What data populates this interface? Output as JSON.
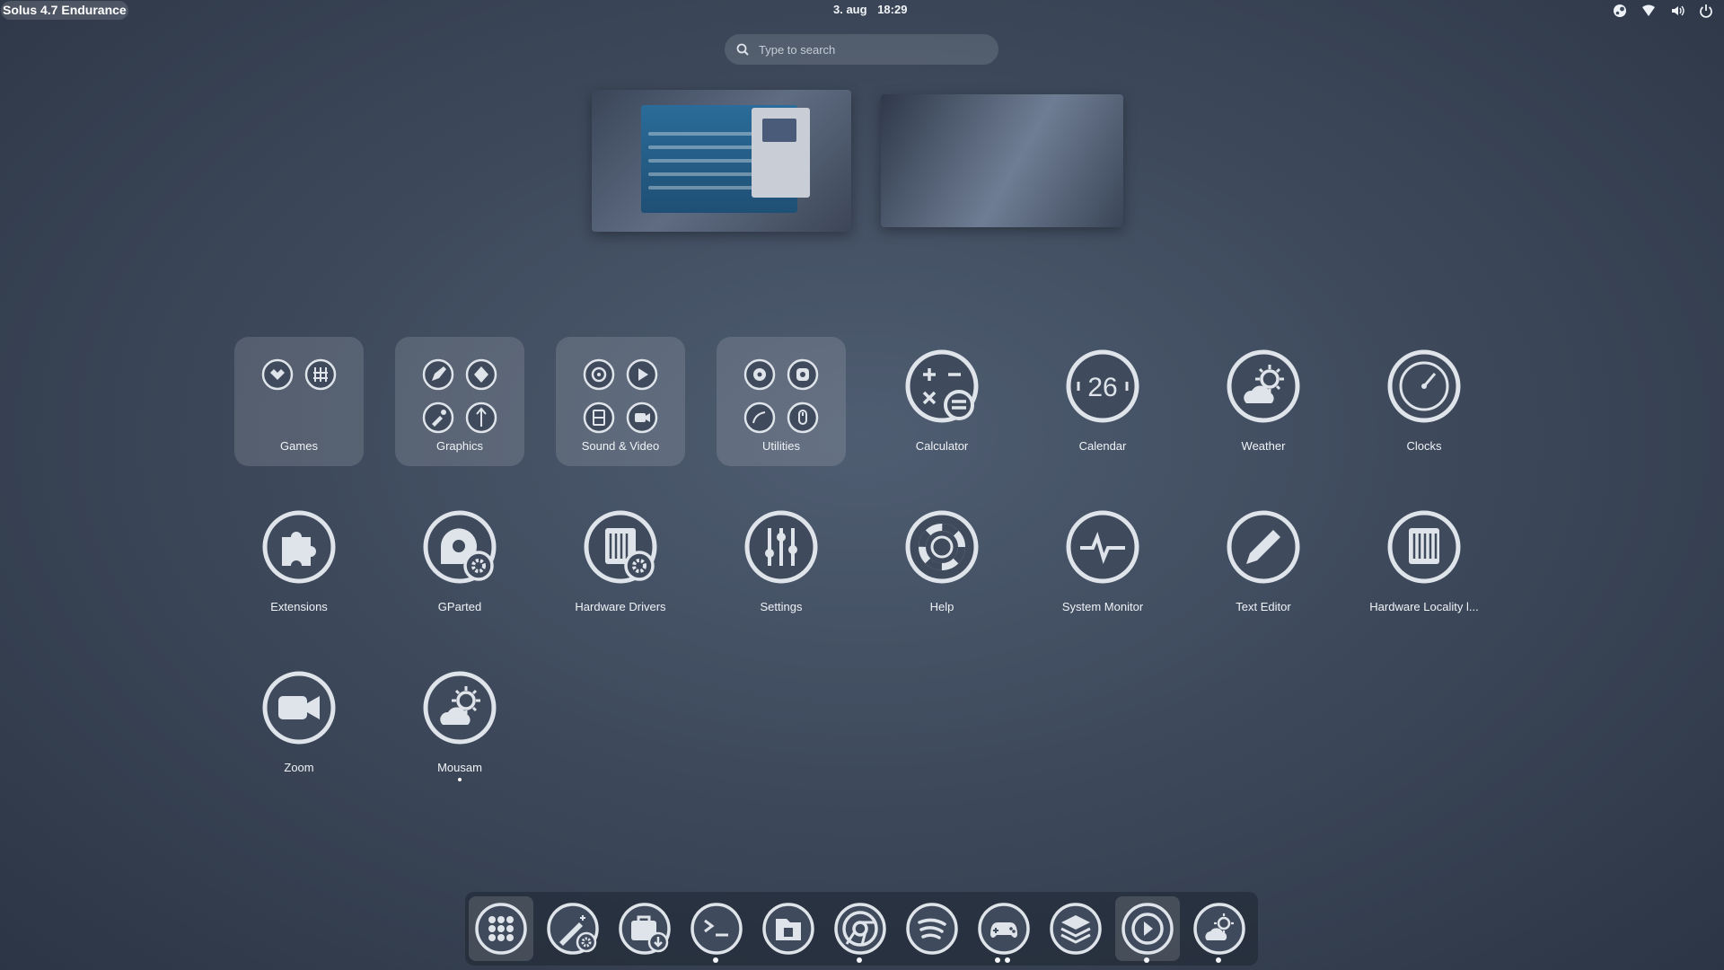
{
  "topbar": {
    "activities": "Solus 4.7 Endurance",
    "date": "3. aug",
    "time": "18:29",
    "tray_icons": [
      "steam-icon",
      "wifi-icon",
      "volume-icon",
      "power-icon"
    ]
  },
  "search": {
    "placeholder": "Type to search"
  },
  "workspaces": [
    "workspace-1",
    "workspace-2"
  ],
  "grid": {
    "row1": [
      {
        "label": "Games",
        "folder": true
      },
      {
        "label": "Graphics",
        "folder": true
      },
      {
        "label": "Sound & Video",
        "folder": true
      },
      {
        "label": "Utilities",
        "folder": true
      },
      {
        "label": "Calculator"
      },
      {
        "label": "Calendar",
        "icon_text": "26"
      },
      {
        "label": "Weather"
      },
      {
        "label": "Clocks"
      }
    ],
    "row2": [
      {
        "label": "Extensions"
      },
      {
        "label": "GParted"
      },
      {
        "label": "Hardware Drivers"
      },
      {
        "label": "Settings"
      },
      {
        "label": "Help"
      },
      {
        "label": "System Monitor"
      },
      {
        "label": "Text Editor"
      },
      {
        "label": "Hardware Locality l..."
      }
    ],
    "row3": [
      {
        "label": "Zoom"
      },
      {
        "label": "Mousam",
        "running": true
      }
    ]
  },
  "dock": {
    "items": [
      {
        "icon": "app-grid-icon",
        "active": true
      },
      {
        "icon": "tweaks-icon"
      },
      {
        "icon": "software-center-icon"
      },
      {
        "icon": "terminal-icon",
        "running": 1
      },
      {
        "icon": "files-icon"
      },
      {
        "icon": "chrome-icon",
        "running": 1
      },
      {
        "icon": "spotify-icon"
      },
      {
        "icon": "games-icon",
        "running": 2
      },
      {
        "icon": "layers-icon"
      },
      {
        "icon": "media-player-icon",
        "active": true,
        "running": 1
      },
      {
        "icon": "weather-icon",
        "running": 1
      }
    ]
  },
  "colors": {
    "icon_fill": "#3f4a5c",
    "icon_ring": "#dfe4ea",
    "accent": "#ffffff"
  }
}
